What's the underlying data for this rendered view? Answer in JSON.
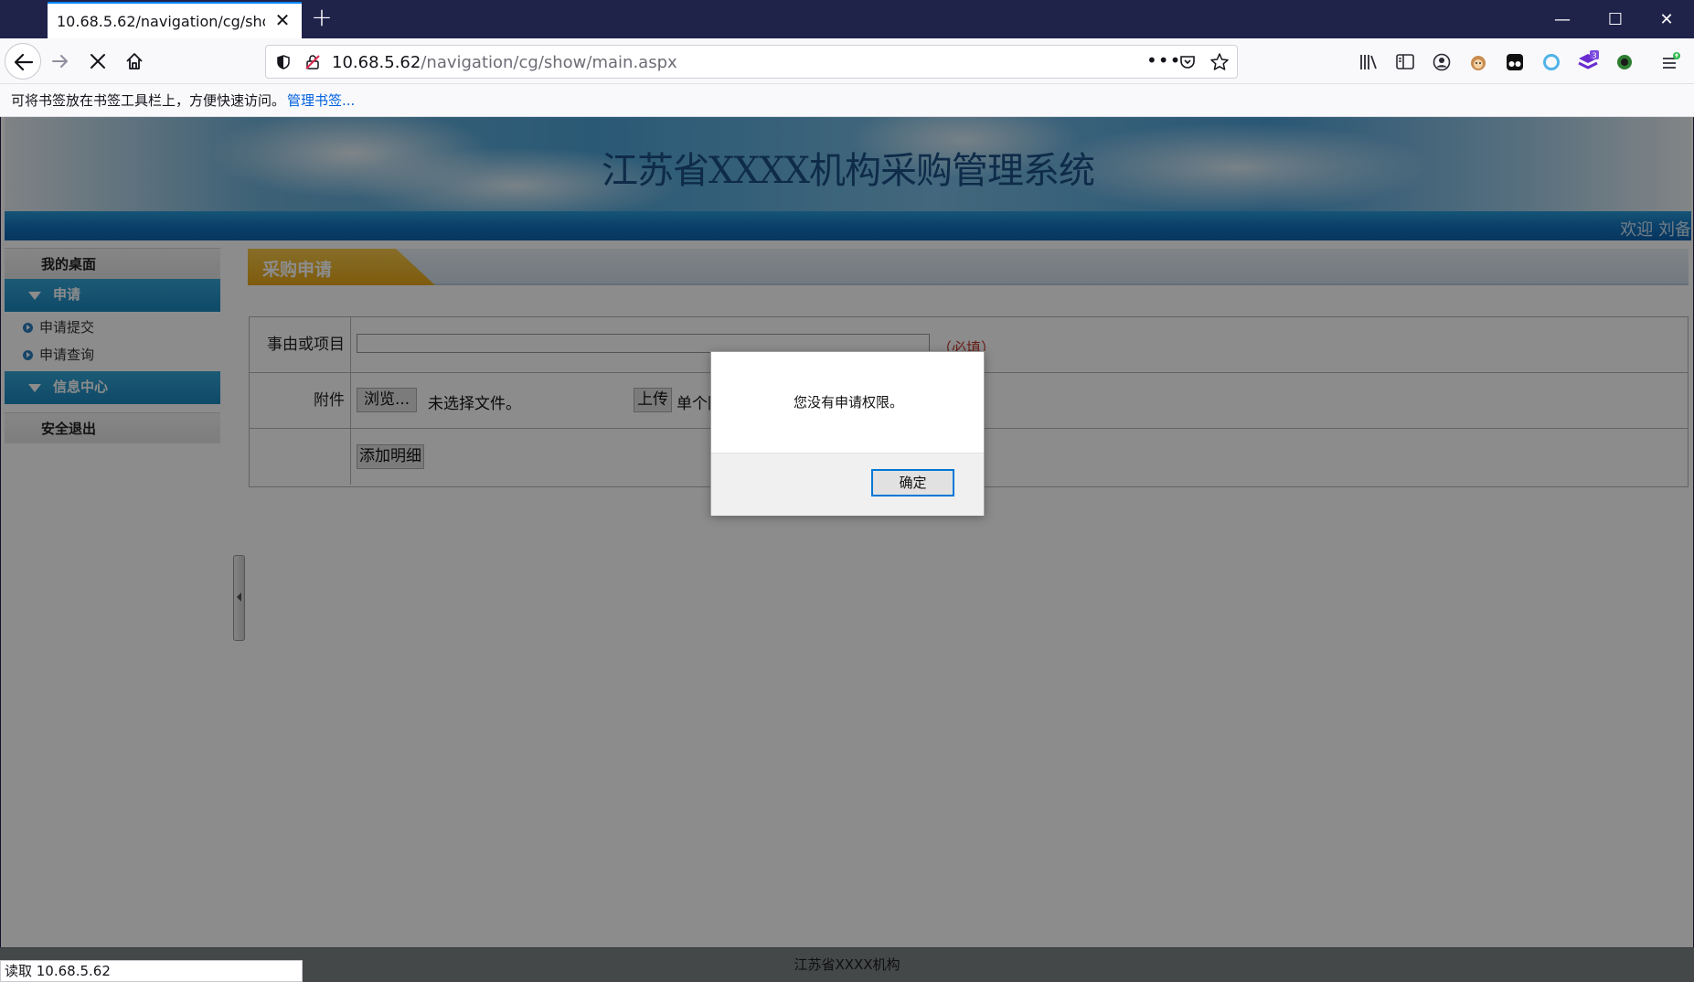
{
  "browser": {
    "tab_title": "10.68.5.62/navigation/cg/show/main.aspx",
    "tab_close": "✕",
    "new_tab": "+",
    "url_host": "10.68.5.62",
    "url_path": "/navigation/cg/show/main.aspx",
    "bookmark_hint": "可将书签放在书签工具栏上，方便快速访问。",
    "bookmark_link": "管理书签...",
    "status_text": "读取 10.68.5.62",
    "extension_badge": "3",
    "window_buttons": {
      "minimize": "—",
      "maximize": "☐",
      "close": "✕"
    },
    "icons": [
      "back-icon",
      "forward-icon",
      "stop-icon",
      "home-icon",
      "shield-icon",
      "insecure-lock-icon",
      "more-icon",
      "pocket-icon",
      "bookmark-star-icon",
      "library-icon",
      "sidebar-icon",
      "account-icon",
      "extension-icons",
      "menu-icon"
    ]
  },
  "site": {
    "title": "江苏省XXXX机构采购管理系统",
    "welcome": "欢迎  刘备",
    "footer": "江苏省XXXX机构"
  },
  "sidebar": {
    "desk": "我的桌面",
    "groups": [
      {
        "label": "申请",
        "items": [
          "申请提交",
          "申请查询"
        ]
      },
      {
        "label": "信息中心",
        "items": []
      }
    ],
    "logout": "安全退出"
  },
  "content": {
    "section_title": "采购申请",
    "form": {
      "subject_label": "事由或项目",
      "subject_value": "",
      "required_note": "（必填）",
      "attachment_label": "附件",
      "browse_button": "浏览...",
      "no_file": "未选择文件。",
      "upload_button": "上传",
      "upload_note": "单个附",
      "add_detail_button": "添加明细"
    }
  },
  "dialog": {
    "message": "您没有申请权限。",
    "ok_button": "确定"
  }
}
